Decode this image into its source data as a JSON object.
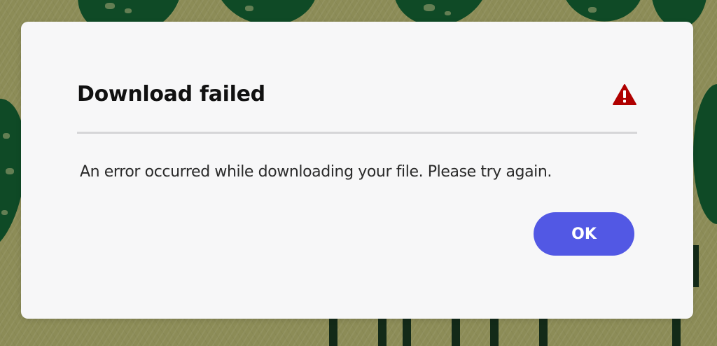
{
  "dialog": {
    "title": "Download failed",
    "message": "An error occurred while downloading your file. Please try again.",
    "icon": "alert-triangle-icon",
    "ok_label": "OK",
    "colors": {
      "alert": "#b00000",
      "button": "#5258e4",
      "button_text": "#ffffff"
    }
  }
}
